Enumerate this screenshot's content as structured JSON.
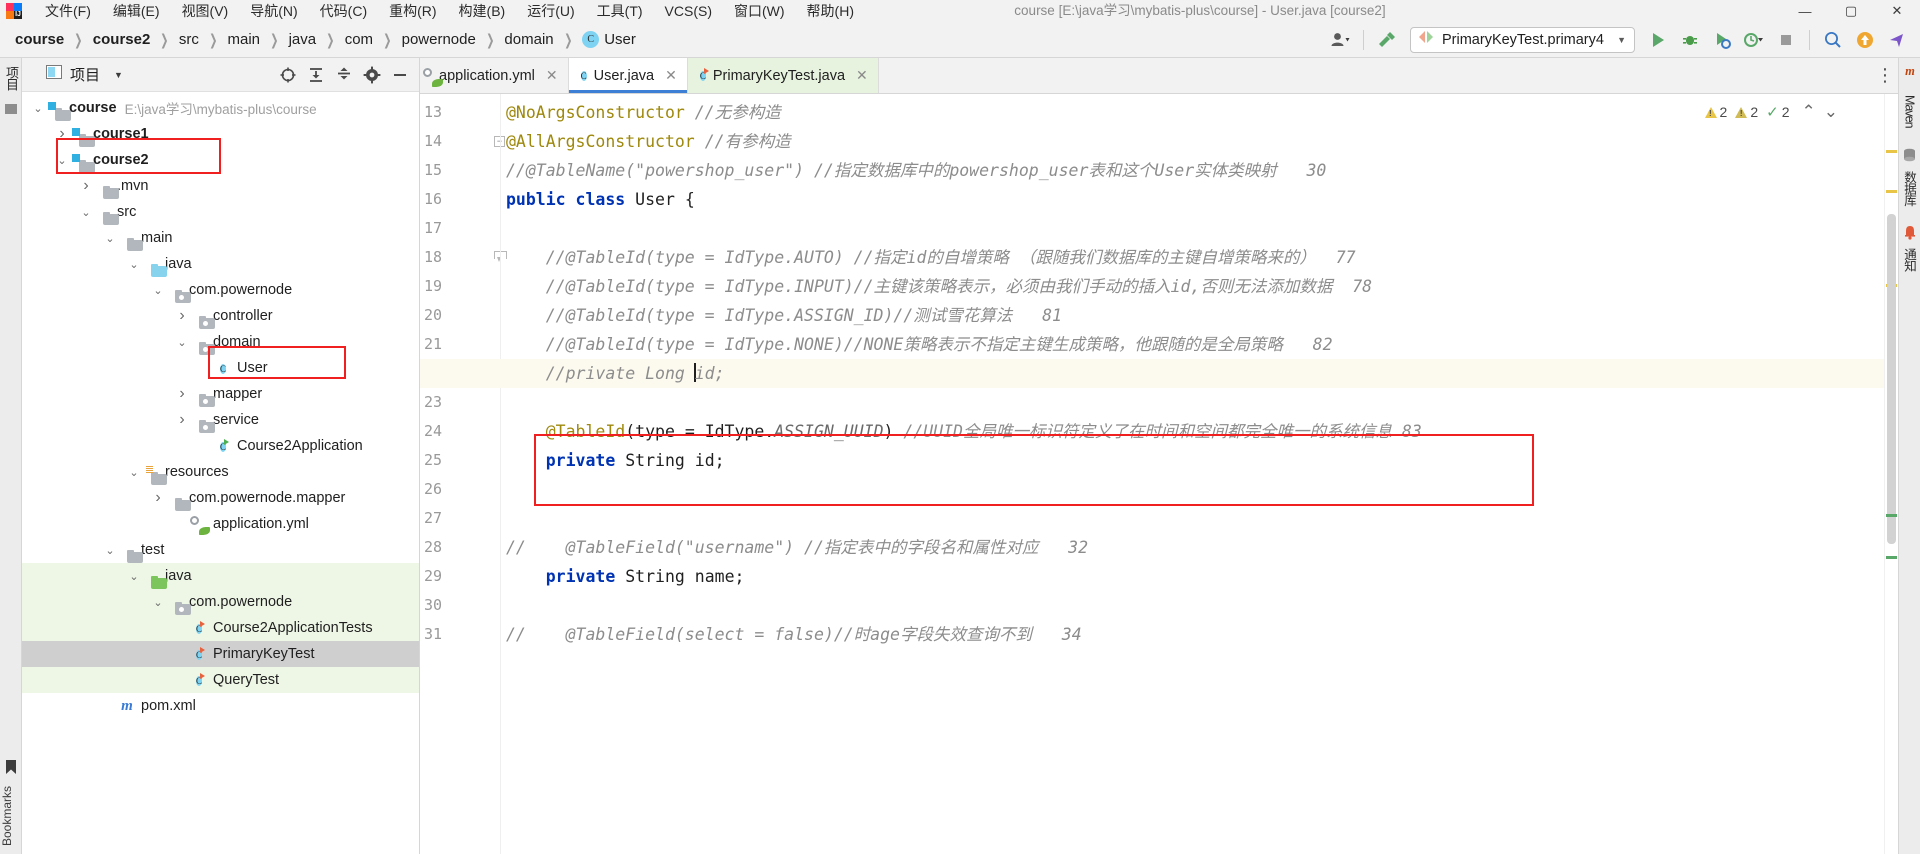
{
  "window": {
    "title": "course [E:\\java学习\\mybatis-plus\\course] - User.java [course2]",
    "minimize": "—",
    "maximize": "▢",
    "close": "✕"
  },
  "menubar": {
    "items": [
      {
        "label": "文件(F)"
      },
      {
        "label": "编辑(E)"
      },
      {
        "label": "视图(V)"
      },
      {
        "label": "导航(N)"
      },
      {
        "label": "代码(C)"
      },
      {
        "label": "重构(R)"
      },
      {
        "label": "构建(B)"
      },
      {
        "label": "运行(U)"
      },
      {
        "label": "工具(T)"
      },
      {
        "label": "VCS(S)"
      },
      {
        "label": "窗口(W)"
      },
      {
        "label": "帮助(H)"
      }
    ]
  },
  "breadcrumb": {
    "items": [
      {
        "label": "course",
        "bold": true
      },
      {
        "label": "course2",
        "bold": true
      },
      {
        "label": "src",
        "bold": false
      },
      {
        "label": "main",
        "bold": false
      },
      {
        "label": "java",
        "bold": false
      },
      {
        "label": "com",
        "bold": false
      },
      {
        "label": "powernode",
        "bold": false
      },
      {
        "label": "domain",
        "bold": false
      },
      {
        "label": "User",
        "bold": false,
        "badge": "C"
      }
    ],
    "separator": "❯"
  },
  "toolbar": {
    "account_icon": "user-account-icon",
    "build_icon": "hammer-icon",
    "run_config": {
      "label": "PrimaryKeyTest.primary4",
      "caret": "▼"
    },
    "run_label": "▶",
    "debug_label": "debug-icon",
    "run_coverage_label": "run-with-coverage-icon",
    "profiler_label": "profiler-icon",
    "stop_label": "■",
    "search_label": "search-icon",
    "update_label": "update-icon",
    "share_label": "share-icon"
  },
  "left_strip": {
    "project_label": "项目",
    "structure_icon": "structure-icon",
    "bookmarks_label": "Bookmarks"
  },
  "right_strip": {
    "items": [
      {
        "label": "m",
        "name": "maven-tool-icon"
      },
      {
        "label": "Maven",
        "name": "maven-tool-window"
      },
      {
        "label": "数据库",
        "name": "database-tool-window"
      },
      {
        "label": "通知",
        "name": "notifications-tool-window"
      }
    ]
  },
  "project_panel": {
    "title": "项目",
    "caret": "▼",
    "actions": [
      {
        "name": "select-opened-file-icon",
        "glyph": "⊕"
      },
      {
        "name": "expand-all-icon",
        "glyph": "⤓"
      },
      {
        "name": "collapse-all-icon",
        "glyph": "⤒"
      },
      {
        "name": "settings-gear-icon",
        "glyph": "⚙"
      },
      {
        "name": "hide-panel-icon",
        "glyph": "—"
      }
    ],
    "tree": [
      {
        "label": "course",
        "sub": "E:\\java学习\\mybatis-plus\\course",
        "indent": 0,
        "arrow": "v",
        "icon": "module-folder",
        "bold": true
      },
      {
        "label": "course1",
        "sub": "",
        "indent": 1,
        "arrow": ">",
        "icon": "module-folder",
        "bold": true
      },
      {
        "label": "course2",
        "sub": "",
        "indent": 1,
        "arrow": "v",
        "icon": "module-folder",
        "bold": true,
        "highlight": "red-box"
      },
      {
        "label": ".mvn",
        "sub": "",
        "indent": 2,
        "arrow": ">",
        "icon": "folder"
      },
      {
        "label": "src",
        "sub": "",
        "indent": 2,
        "arrow": "v",
        "icon": "folder"
      },
      {
        "label": "main",
        "sub": "",
        "indent": 3,
        "arrow": "v",
        "icon": "folder"
      },
      {
        "label": "java",
        "sub": "",
        "indent": 4,
        "arrow": "v",
        "icon": "source-folder-blue"
      },
      {
        "label": "com.powernode",
        "sub": "",
        "indent": 5,
        "arrow": "v",
        "icon": "package"
      },
      {
        "label": "controller",
        "sub": "",
        "indent": 6,
        "arrow": ">",
        "icon": "package"
      },
      {
        "label": "domain",
        "sub": "",
        "indent": 6,
        "arrow": "v",
        "icon": "package"
      },
      {
        "label": "User",
        "sub": "",
        "indent": 7,
        "arrow": "",
        "icon": "class",
        "highlight": "red-box"
      },
      {
        "label": "mapper",
        "sub": "",
        "indent": 6,
        "arrow": ">",
        "icon": "package"
      },
      {
        "label": "service",
        "sub": "",
        "indent": 6,
        "arrow": ">",
        "icon": "package"
      },
      {
        "label": "Course2Application",
        "sub": "",
        "indent": 7,
        "arrow": "",
        "icon": "spring-class"
      },
      {
        "label": "resources",
        "sub": "",
        "indent": 4,
        "arrow": "v",
        "icon": "resources-folder"
      },
      {
        "label": "com.powernode.mapper",
        "sub": "",
        "indent": 5,
        "arrow": ">",
        "icon": "folder"
      },
      {
        "label": "application.yml",
        "sub": "",
        "indent": 6,
        "arrow": "",
        "icon": "spring-yml"
      },
      {
        "label": "test",
        "sub": "",
        "indent": 3,
        "arrow": "v",
        "icon": "folder"
      },
      {
        "label": "java",
        "sub": "",
        "indent": 4,
        "arrow": "v",
        "icon": "test-folder-green",
        "green": true
      },
      {
        "label": "com.powernode",
        "sub": "",
        "indent": 5,
        "arrow": "v",
        "icon": "package",
        "green": true
      },
      {
        "label": "Course2ApplicationTests",
        "sub": "",
        "indent": 6,
        "arrow": "",
        "icon": "test-class",
        "green": true
      },
      {
        "label": "PrimaryKeyTest",
        "sub": "",
        "indent": 6,
        "arrow": "",
        "icon": "test-class",
        "selected": true
      },
      {
        "label": "QueryTest",
        "sub": "",
        "indent": 6,
        "arrow": "",
        "icon": "test-class",
        "green": true
      },
      {
        "label": "pom.xml",
        "sub": "",
        "indent": 3,
        "arrow": "",
        "icon": "maven-pom"
      }
    ]
  },
  "editor": {
    "tabs": [
      {
        "label": "application.yml",
        "icon": "spring-yml-icon",
        "state": "inactive",
        "close": "✕"
      },
      {
        "label": "User.java",
        "icon": "class-icon",
        "state": "active",
        "close": "✕"
      },
      {
        "label": "PrimaryKeyTest.java",
        "icon": "test-class-icon",
        "state": "green",
        "close": "✕"
      }
    ],
    "more_icon": "⋮",
    "inspections": {
      "warnings_1": "2",
      "warnings_2": "2",
      "checks": "2",
      "up_arrow": "⌃",
      "down_arrow": "⌄"
    },
    "lines": [
      {
        "num": "13",
        "fold": "",
        "parts": [
          {
            "t": "@NoArgsConstructor",
            "c": "ann"
          },
          {
            "t": " ",
            "c": "plain"
          },
          {
            "t": "//无参构造",
            "c": "cmt"
          }
        ]
      },
      {
        "num": "14",
        "fold": "foldbox",
        "parts": [
          {
            "t": "@AllArgsConstructor",
            "c": "ann"
          },
          {
            "t": " ",
            "c": "plain"
          },
          {
            "t": "//有参构造",
            "c": "cmt"
          }
        ]
      },
      {
        "num": "15",
        "fold": "",
        "parts": [
          {
            "t": "//@TableName(\"powershop_user\") //指定数据库中的powershop_user表和这个User实体类映射",
            "c": "cmt"
          },
          {
            "t": "   30",
            "c": "cmt"
          }
        ]
      },
      {
        "num": "16",
        "fold": "",
        "parts": [
          {
            "t": "public",
            "c": "kw"
          },
          {
            "t": " ",
            "c": "plain"
          },
          {
            "t": "class",
            "c": "kw"
          },
          {
            "t": " User {",
            "c": "plain"
          }
        ]
      },
      {
        "num": "17",
        "fold": "",
        "parts": []
      },
      {
        "num": "18",
        "fold": "foldend",
        "parts": [
          {
            "t": "    //@TableId(type = IdType.AUTO) //指定id的自增策略 （跟随我们数据库的主键自增策略来的）",
            "c": "cmt"
          },
          {
            "t": "  77",
            "c": "cmt"
          }
        ]
      },
      {
        "num": "19",
        "fold": "",
        "parts": [
          {
            "t": "    //@TableId(type = IdType.INPUT)//主键该策略表示，必须由我们手动的插入id,否则无法添加数据",
            "c": "cmt"
          },
          {
            "t": "  78",
            "c": "cmt"
          }
        ]
      },
      {
        "num": "20",
        "fold": "",
        "parts": [
          {
            "t": "    //@TableId(type = IdType.ASSIGN_ID)//测试雪花算法   81",
            "c": "cmt"
          }
        ]
      },
      {
        "num": "21",
        "fold": "",
        "parts": [
          {
            "t": "    //@TableId(type = IdType.NONE)//NONE策略表示不指定主键生成策略，他跟随的是全局策略   82",
            "c": "cmt"
          }
        ]
      },
      {
        "num": "22",
        "fold": "foldend",
        "highlight": true,
        "parts": [
          {
            "t": "    //private Long ",
            "c": "cmt"
          },
          {
            "t": "CURSOR",
            "c": "cursor"
          },
          {
            "t": "id;",
            "c": "cmt"
          }
        ]
      },
      {
        "num": "23",
        "fold": "",
        "parts": []
      },
      {
        "num": "24",
        "fold": "",
        "boxed": true,
        "parts": [
          {
            "t": "    @TableId",
            "c": "ann"
          },
          {
            "t": "(type = IdType.",
            "c": "plain"
          },
          {
            "t": "ASSIGN_UUID",
            "c": "italicid"
          },
          {
            "t": ") ",
            "c": "plain"
          },
          {
            "t": "//UUID全局唯一标识符定义了在时间和空间都完全唯一的系统信息",
            "c": "cmt"
          },
          {
            "t": " 83",
            "c": "cmt"
          }
        ]
      },
      {
        "num": "25",
        "fold": "",
        "boxed": true,
        "parts": [
          {
            "t": "    private",
            "c": "kw"
          },
          {
            "t": " String ",
            "c": "plain"
          },
          {
            "t": "id;",
            "c": "plain"
          }
        ]
      },
      {
        "num": "26",
        "fold": "",
        "parts": []
      },
      {
        "num": "27",
        "fold": "",
        "parts": []
      },
      {
        "num": "28",
        "fold": "",
        "parts": [
          {
            "t": "//    @TableField(\"username\") //指定表中的字段名和属性对应   32",
            "c": "cmt"
          }
        ]
      },
      {
        "num": "29",
        "fold": "",
        "parts": [
          {
            "t": "    private",
            "c": "kw"
          },
          {
            "t": " String ",
            "c": "plain"
          },
          {
            "t": "name;",
            "c": "plain"
          }
        ]
      },
      {
        "num": "30",
        "fold": "",
        "parts": []
      },
      {
        "num": "31",
        "fold": "",
        "parts": [
          {
            "t": "//    @TableField(select = false)//时age字段失效查询不到   34",
            "c": "cmt"
          }
        ]
      }
    ]
  }
}
